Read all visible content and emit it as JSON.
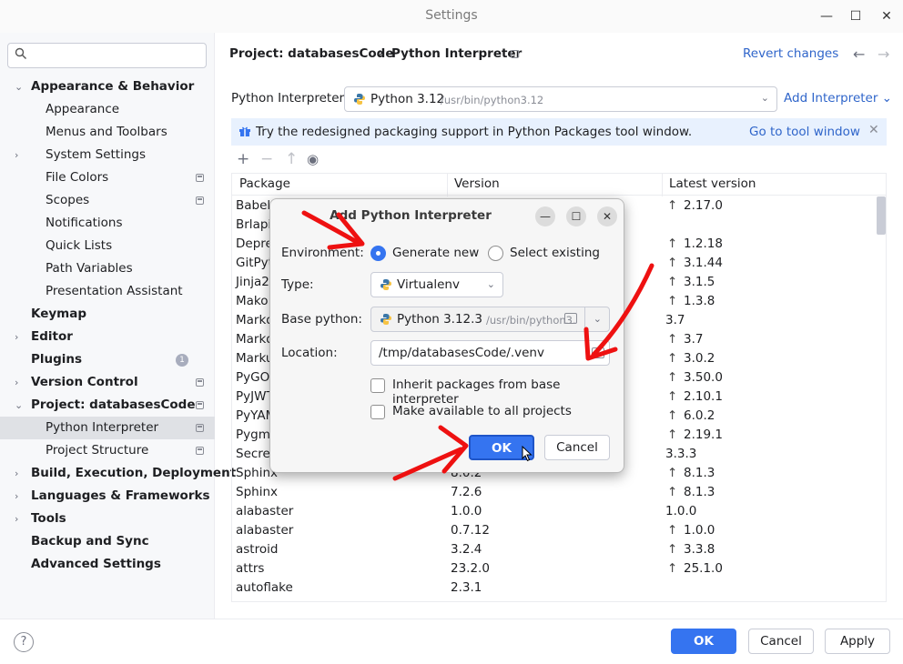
{
  "window": {
    "title": "Settings",
    "controls": [
      "—",
      "☐",
      "✕"
    ]
  },
  "search": {
    "placeholder": "",
    "icon": "search-icon"
  },
  "sidebar": {
    "items": [
      {
        "label": "Appearance & Behavior",
        "level": 0,
        "bold": true,
        "chevron": "⌄",
        "scope": false
      },
      {
        "label": "Appearance",
        "level": 1,
        "bold": false,
        "chevron": "",
        "scope": false
      },
      {
        "label": "Menus and Toolbars",
        "level": 1,
        "bold": false,
        "chevron": "",
        "scope": false
      },
      {
        "label": "System Settings",
        "level": 1,
        "bold": false,
        "chevron": "›",
        "scope": false
      },
      {
        "label": "File Colors",
        "level": 1,
        "bold": false,
        "chevron": "",
        "scope": true
      },
      {
        "label": "Scopes",
        "level": 1,
        "bold": false,
        "chevron": "",
        "scope": true
      },
      {
        "label": "Notifications",
        "level": 1,
        "bold": false,
        "chevron": "",
        "scope": false
      },
      {
        "label": "Quick Lists",
        "level": 1,
        "bold": false,
        "chevron": "",
        "scope": false
      },
      {
        "label": "Path Variables",
        "level": 1,
        "bold": false,
        "chevron": "",
        "scope": false
      },
      {
        "label": "Presentation Assistant",
        "level": 1,
        "bold": false,
        "chevron": "",
        "scope": false
      },
      {
        "label": "Keymap",
        "level": 0,
        "bold": true,
        "chevron": "",
        "scope": false
      },
      {
        "label": "Editor",
        "level": 0,
        "bold": true,
        "chevron": "›",
        "scope": false
      },
      {
        "label": "Plugins",
        "level": 0,
        "bold": true,
        "chevron": "",
        "scope": false,
        "count": "1"
      },
      {
        "label": "Version Control",
        "level": 0,
        "bold": true,
        "chevron": "›",
        "scope": true
      },
      {
        "label": "Project: databasesCode",
        "level": 0,
        "bold": true,
        "chevron": "⌄",
        "scope": true
      },
      {
        "label": "Python Interpreter",
        "level": 1,
        "bold": false,
        "chevron": "",
        "scope": true,
        "selected": true
      },
      {
        "label": "Project Structure",
        "level": 1,
        "bold": false,
        "chevron": "",
        "scope": true
      },
      {
        "label": "Build, Execution, Deployment",
        "level": 0,
        "bold": true,
        "chevron": "›",
        "scope": false
      },
      {
        "label": "Languages & Frameworks",
        "level": 0,
        "bold": true,
        "chevron": "›",
        "scope": false
      },
      {
        "label": "Tools",
        "level": 0,
        "bold": true,
        "chevron": "›",
        "scope": false
      },
      {
        "label": "Backup and Sync",
        "level": 0,
        "bold": true,
        "chevron": "",
        "scope": false
      },
      {
        "label": "Advanced Settings",
        "level": 0,
        "bold": true,
        "chevron": "",
        "scope": false
      }
    ]
  },
  "header": {
    "crumb_project": "Project: databasesCode",
    "crumb_sep": "›",
    "crumb_page": "Python Interpreter",
    "revert": "Revert changes",
    "back": "←",
    "forward": "→"
  },
  "interpreter": {
    "label": "Python Interpreter:",
    "value": "Python 3.12",
    "path": "/usr/bin/python3.12",
    "add": "Add Interpreter ⌄"
  },
  "banner": {
    "message": "Try the redesigned packaging support in Python Packages tool window.",
    "link": "Go to tool window",
    "close": "✕"
  },
  "toolbar": {
    "add": "+",
    "remove": "−",
    "upgrade": "↑",
    "show": "◉"
  },
  "table": {
    "columns": [
      "Package",
      "Version",
      "Latest version"
    ],
    "rows": [
      {
        "package": "Babel",
        "version": "",
        "latest": "2.17.0",
        "upgrade": true
      },
      {
        "package": "Brlapi",
        "version": "",
        "latest": "",
        "upgrade": false
      },
      {
        "package": "Deprec",
        "version": "",
        "latest": "1.2.18",
        "upgrade": true
      },
      {
        "package": "GitPyth",
        "version": "",
        "latest": "3.1.44",
        "upgrade": true
      },
      {
        "package": "Jinja2",
        "version": "",
        "latest": "3.1.5",
        "upgrade": true
      },
      {
        "package": "Mako",
        "version": "",
        "latest": "1.3.8",
        "upgrade": true
      },
      {
        "package": "Markd",
        "version": "",
        "latest": "3.7",
        "upgrade": false
      },
      {
        "package": "Markd",
        "version": "",
        "latest": "3.7",
        "upgrade": true
      },
      {
        "package": "Marku",
        "version": "",
        "latest": "3.0.2",
        "upgrade": true
      },
      {
        "package": "PyGOb",
        "version": "",
        "latest": "3.50.0",
        "upgrade": true
      },
      {
        "package": "PyJWT",
        "version": "",
        "latest": "2.10.1",
        "upgrade": true
      },
      {
        "package": "PyYAM",
        "version": "",
        "latest": "6.0.2",
        "upgrade": true
      },
      {
        "package": "Pygme",
        "version": "",
        "latest": "2.19.1",
        "upgrade": true
      },
      {
        "package": "Secret",
        "version": "",
        "latest": "3.3.3",
        "upgrade": false
      },
      {
        "package": "Sphinx",
        "version": "8.0.2",
        "latest": "8.1.3",
        "upgrade": true
      },
      {
        "package": "Sphinx",
        "version": "7.2.6",
        "latest": "8.1.3",
        "upgrade": true
      },
      {
        "package": "alabaster",
        "version": "1.0.0",
        "latest": "1.0.0",
        "upgrade": false
      },
      {
        "package": "alabaster",
        "version": "0.7.12",
        "latest": "1.0.0",
        "upgrade": true
      },
      {
        "package": "astroid",
        "version": "3.2.4",
        "latest": "3.3.8",
        "upgrade": true
      },
      {
        "package": "attrs",
        "version": "23.2.0",
        "latest": "25.1.0",
        "upgrade": true
      },
      {
        "package": "autoflake",
        "version": "2.3.1",
        "latest": "",
        "upgrade": false
      }
    ]
  },
  "footer": {
    "help": "?",
    "ok": "OK",
    "cancel": "Cancel",
    "apply": "Apply"
  },
  "dialog": {
    "title": "Add Python Interpreter",
    "controls": [
      "—",
      "☐",
      "✕"
    ],
    "environment_label": "Environment:",
    "option_new": "Generate new",
    "option_existing": "Select existing",
    "type_label": "Type:",
    "type_value": "Virtualenv",
    "base_label": "Base python:",
    "base_value": "Python 3.12.3",
    "base_path": "/usr/bin/python3.",
    "location_label": "Location:",
    "location_value": "/tmp/databasesCode/.venv",
    "inherit": "Inherit packages from base interpreter",
    "available": "Make available to all projects",
    "ok": "OK",
    "cancel": "Cancel"
  },
  "colors": {
    "accent": "#3574f0",
    "link": "#2f65ca",
    "banner_bg": "#e8f1fe",
    "annotation": "#ee1111"
  }
}
